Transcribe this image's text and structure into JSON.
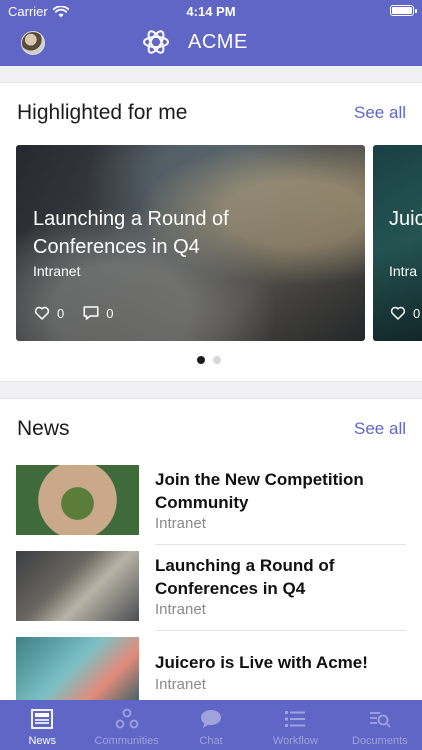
{
  "status_bar": {
    "carrier": "Carrier",
    "time": "4:14 PM"
  },
  "header": {
    "app_name": "ACME"
  },
  "highlighted": {
    "title": "Highlighted for me",
    "see_all": "See all",
    "slides": [
      {
        "title": "Launching a Round of Conferences in Q4",
        "source": "Intranet",
        "likes": "0",
        "comments": "0"
      },
      {
        "title": "Juic",
        "source": "Intra",
        "likes": "0"
      }
    ],
    "pager": {
      "count": 2,
      "active": 1
    }
  },
  "news": {
    "title": "News",
    "see_all": "See all",
    "items": [
      {
        "title": "Join the New Competition Community",
        "source": "Intranet"
      },
      {
        "title": "Launching a Round of Conferences in Q4",
        "source": "Intranet"
      },
      {
        "title": "Juicero is Live with Acme!",
        "source": "Intranet"
      }
    ]
  },
  "tabbar": {
    "tabs": [
      {
        "label": "News",
        "icon": "news-icon",
        "active": true
      },
      {
        "label": "Communities",
        "icon": "communities-icon",
        "active": false
      },
      {
        "label": "Chat",
        "icon": "chat-icon",
        "active": false
      },
      {
        "label": "Workflow",
        "icon": "workflow-icon",
        "active": false
      },
      {
        "label": "Documents",
        "icon": "documents-icon",
        "active": false
      }
    ]
  },
  "colors": {
    "brand": "#5f66c6",
    "tab_inactive": "#9ea3dd"
  }
}
